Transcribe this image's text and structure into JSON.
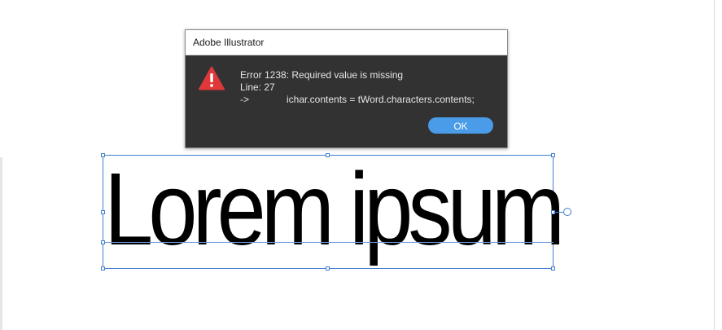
{
  "dialog": {
    "title": "Adobe Illustrator",
    "icon": "error-triangle-icon",
    "message": {
      "error_line": "Error 1238: Required value is missing",
      "line_line": "Line: 27",
      "arrow": "->",
      "code": "ichar.contents = tWord.characters.contents;"
    },
    "ok_label": "OK"
  },
  "canvas": {
    "text_content": "Lorem ipsum"
  },
  "colors": {
    "dialog_bg": "#323232",
    "accent": "#4a9be8",
    "error_red": "#e0383a",
    "selection": "#3f7fd0"
  }
}
